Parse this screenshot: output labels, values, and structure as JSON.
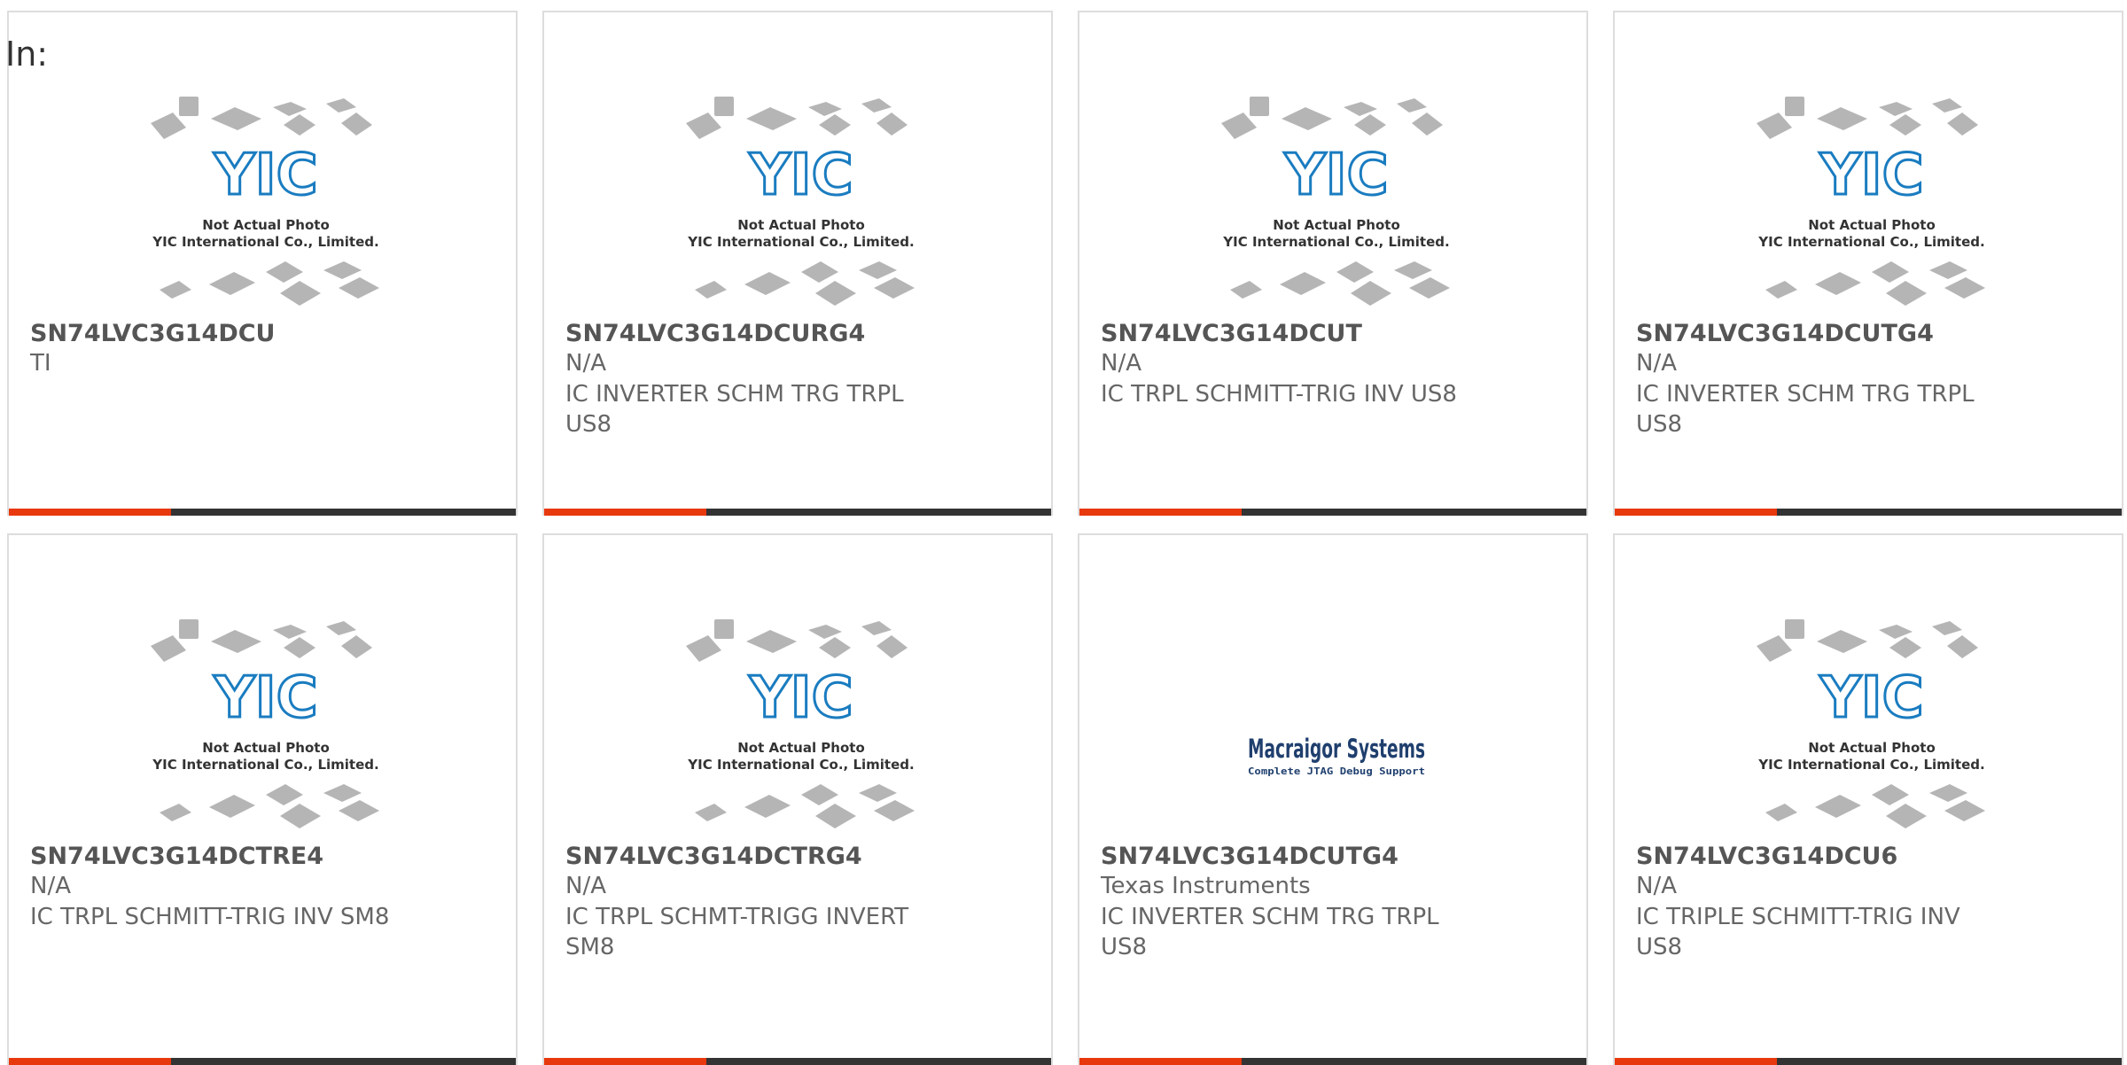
{
  "filter": {
    "label": "In:"
  },
  "image_caption": {
    "line1": "Not Actual Photo",
    "line2": "YIC International Co., Limited.",
    "brand": "YIC"
  },
  "macraigor_logo": {
    "line1": "Macraigor Systems",
    "line2": "Complete JTAG Debug Support"
  },
  "colors": {
    "accent": "#e8380d",
    "bar_dark": "#333333",
    "brand_blue": "#1a7cc0",
    "macraigor_navy": "#1f3f6e"
  },
  "products": [
    {
      "part": "SN74LVC3G14DCU",
      "manufacturer": "TI",
      "description": "",
      "image": "yic-placeholder"
    },
    {
      "part": "SN74LVC3G14DCURG4",
      "manufacturer": "N/A",
      "description": "IC INVERTER SCHM TRG TRPL US8",
      "image": "yic-placeholder"
    },
    {
      "part": "SN74LVC3G14DCUT",
      "manufacturer": "N/A",
      "description": "IC TRPL SCHMITT-TRIG INV US8",
      "image": "yic-placeholder"
    },
    {
      "part": "SN74LVC3G14DCUTG4",
      "manufacturer": "N/A",
      "description": "IC INVERTER SCHM TRG TRPL US8",
      "image": "yic-placeholder"
    },
    {
      "part": "SN74LVC3G14DCTRE4",
      "manufacturer": "N/A",
      "description": "IC TRPL SCHMITT-TRIG INV SM8",
      "image": "yic-placeholder"
    },
    {
      "part": "SN74LVC3G14DCTRG4",
      "manufacturer": "N/A",
      "description": "IC TRPL SCHMT-TRIGG INVERT SM8",
      "image": "yic-placeholder"
    },
    {
      "part": "SN74LVC3G14DCUTG4",
      "manufacturer": "Texas Instruments",
      "description": "IC INVERTER SCHM TRG TRPL US8",
      "image": "macraigor-logo"
    },
    {
      "part": "SN74LVC3G14DCU6",
      "manufacturer": "N/A",
      "description": "IC TRIPLE SCHMITT-TRIG INV US8",
      "image": "yic-placeholder"
    }
  ]
}
